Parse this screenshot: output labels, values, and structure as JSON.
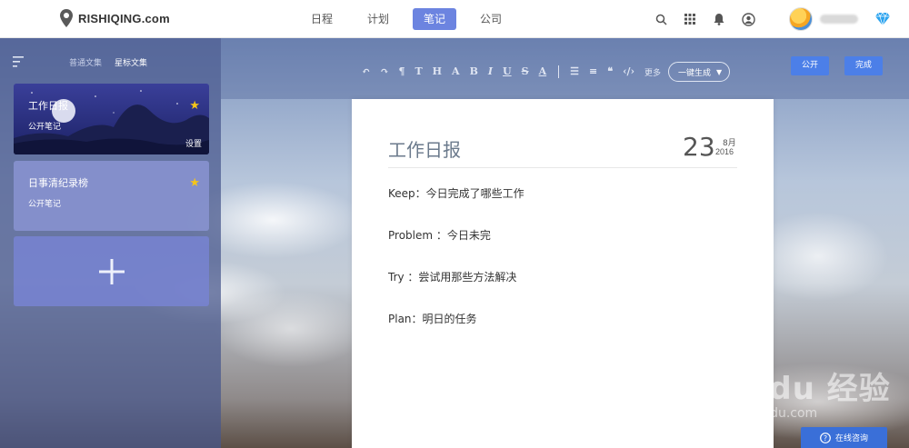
{
  "brand": {
    "name": "RISHIQING.com"
  },
  "nav": {
    "tabs": [
      {
        "label": "日程",
        "active": false
      },
      {
        "label": "计划",
        "active": false
      },
      {
        "label": "笔记",
        "active": true
      },
      {
        "label": "公司",
        "active": false
      }
    ],
    "icons": [
      "search-icon",
      "apps-grid-icon",
      "bell-icon",
      "user-circle-icon",
      "diamond-icon"
    ]
  },
  "sidebar": {
    "tabs": [
      {
        "label": "普通文集",
        "active": false
      },
      {
        "label": "星标文集",
        "active": true
      }
    ],
    "cards": [
      {
        "title": "工作日报",
        "subtitle": "公开笔记",
        "starred": true,
        "settings_label": "设置"
      },
      {
        "title": "日事清纪录榜",
        "subtitle": "公开笔记",
        "starred": true
      }
    ]
  },
  "toolbar": {
    "icons": [
      "undo-icon",
      "redo-icon",
      "paint-format-icon",
      "T",
      "H",
      "A",
      "B",
      "I",
      "U",
      "S",
      "A"
    ],
    "list_icons": [
      "ordered-list-icon",
      "bullet-list-icon",
      "quote-icon",
      "code-icon"
    ],
    "more_label": "更多",
    "generate_label": "一键生成",
    "public_label": "公开",
    "done_label": "完成"
  },
  "note": {
    "title": "工作日报",
    "day": "23",
    "month": "8月",
    "year": "2016",
    "lines": [
      "Keep：今日完成了哪些工作",
      "Problem ：今日未完",
      "Try ：尝试用那些方法解决",
      "Plan：明日的任务"
    ]
  },
  "watermark": {
    "main": "Bai du 经验",
    "sub": "jingyan.baidu.com"
  },
  "consult": {
    "label": "在线咨询"
  },
  "colors": {
    "accent": "#6c84e0",
    "button": "#4c7fe8",
    "star": "#f5c518"
  }
}
